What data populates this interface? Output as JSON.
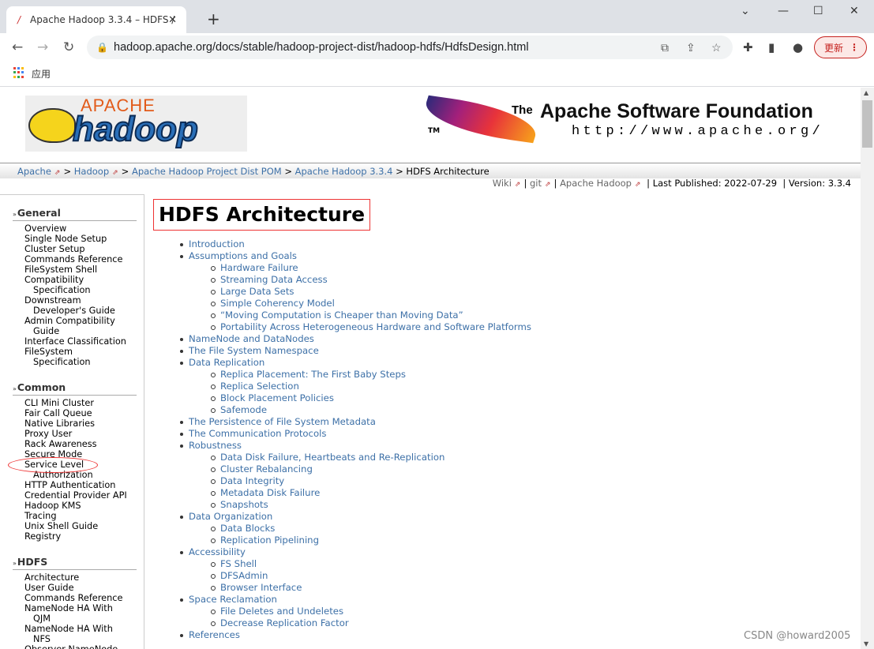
{
  "browser": {
    "tab_title": "Apache Hadoop 3.3.4 – HDFS Architecture",
    "tab_title_visible": "Apache Hadoop 3.3.4 – HDFS /",
    "url": "hadoop.apache.org/docs/stable/hadoop-project-dist/hadoop-hdfs/HdfsDesign.html",
    "update_label": "更新",
    "bookmark_apps": "应用"
  },
  "header": {
    "logo_text": "APACHE hadoop",
    "asf_the": "The",
    "asf_name": "Apache Software Foundation",
    "asf_url": "http://www.apache.org/",
    "asf_tm": "TM"
  },
  "breadcrumb": [
    {
      "label": "Apache",
      "ext": true
    },
    {
      "label": "Hadoop",
      "ext": true
    },
    {
      "label": "Apache Hadoop Project Dist POM"
    },
    {
      "label": "Apache Hadoop 3.3.4"
    },
    {
      "label": "HDFS Architecture",
      "current": true
    }
  ],
  "pubbar": {
    "wiki": "Wiki",
    "git": "git",
    "apache_hadoop": "Apache Hadoop",
    "published": "Last Published: 2022-07-29",
    "version": "Version: 3.3.4"
  },
  "sidebar": [
    {
      "title": "General",
      "items": [
        [
          "Overview"
        ],
        [
          "Single Node Setup"
        ],
        [
          "Cluster Setup"
        ],
        [
          "Commands Reference"
        ],
        [
          "FileSystem Shell"
        ],
        [
          "Compatibility",
          "Specification"
        ],
        [
          "Downstream",
          "Developer's Guide"
        ],
        [
          "Admin Compatibility",
          "Guide"
        ],
        [
          "Interface Classification"
        ],
        [
          "FileSystem",
          "Specification"
        ]
      ]
    },
    {
      "title": "Common",
      "items": [
        [
          "CLI Mini Cluster"
        ],
        [
          "Fair Call Queue"
        ],
        [
          "Native Libraries"
        ],
        [
          "Proxy User"
        ],
        [
          "Rack Awareness"
        ],
        [
          "Secure Mode"
        ],
        [
          "Service Level",
          "Authorization"
        ],
        [
          "HTTP Authentication"
        ],
        [
          "Credential Provider API"
        ],
        [
          "Hadoop KMS"
        ],
        [
          "Tracing"
        ],
        [
          "Unix Shell Guide"
        ],
        [
          "Registry"
        ]
      ]
    },
    {
      "title": "HDFS",
      "items": [
        [
          "Architecture"
        ],
        [
          "User Guide"
        ],
        [
          "Commands Reference"
        ],
        [
          "NameNode HA With",
          "QJM"
        ],
        [
          "NameNode HA With",
          "NFS"
        ],
        [
          "Observer NameNode"
        ]
      ]
    }
  ],
  "main": {
    "title": "HDFS Architecture",
    "toc": [
      {
        "label": "Introduction",
        "level": 1
      },
      {
        "label": "Assumptions and Goals",
        "level": 1
      },
      {
        "label": "Hardware Failure",
        "level": 2
      },
      {
        "label": "Streaming Data Access",
        "level": 2
      },
      {
        "label": "Large Data Sets",
        "level": 2
      },
      {
        "label": "Simple Coherency Model",
        "level": 2
      },
      {
        "label": "“Moving Computation is Cheaper than Moving Data”",
        "level": 2
      },
      {
        "label": "Portability Across Heterogeneous Hardware and Software Platforms",
        "level": 2
      },
      {
        "label": "NameNode and DataNodes",
        "level": 1
      },
      {
        "label": "The File System Namespace",
        "level": 1
      },
      {
        "label": "Data Replication",
        "level": 1
      },
      {
        "label": "Replica Placement: The First Baby Steps",
        "level": 2
      },
      {
        "label": "Replica Selection",
        "level": 2
      },
      {
        "label": "Block Placement Policies",
        "level": 2
      },
      {
        "label": "Safemode",
        "level": 2
      },
      {
        "label": "The Persistence of File System Metadata",
        "level": 1
      },
      {
        "label": "The Communication Protocols",
        "level": 1
      },
      {
        "label": "Robustness",
        "level": 1
      },
      {
        "label": "Data Disk Failure, Heartbeats and Re-Replication",
        "level": 2
      },
      {
        "label": "Cluster Rebalancing",
        "level": 2
      },
      {
        "label": "Data Integrity",
        "level": 2
      },
      {
        "label": "Metadata Disk Failure",
        "level": 2
      },
      {
        "label": "Snapshots",
        "level": 2
      },
      {
        "label": "Data Organization",
        "level": 1
      },
      {
        "label": "Data Blocks",
        "level": 2
      },
      {
        "label": "Replication Pipelining",
        "level": 2
      },
      {
        "label": "Accessibility",
        "level": 1
      },
      {
        "label": "FS Shell",
        "level": 2
      },
      {
        "label": "DFSAdmin",
        "level": 2
      },
      {
        "label": "Browser Interface",
        "level": 2
      },
      {
        "label": "Space Reclamation",
        "level": 1
      },
      {
        "label": "File Deletes and Undeletes",
        "level": 2
      },
      {
        "label": "Decrease Replication Factor",
        "level": 2
      },
      {
        "label": "References",
        "level": 1
      }
    ]
  },
  "watermark": "CSDN @howard2005",
  "colors": {
    "link": "#3d70a7",
    "annotation": "#e33333",
    "update": "#c5221f"
  }
}
